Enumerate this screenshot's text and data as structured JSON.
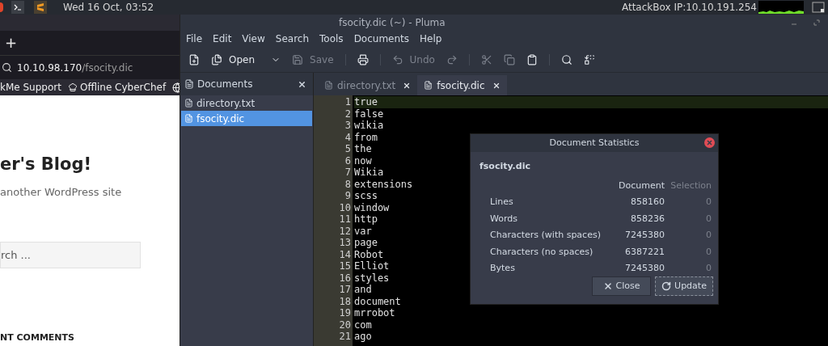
{
  "top_bar": {
    "clock": "Wed 16 Oct, 03:52",
    "attackbox": "AttackBox IP:10.10.191.254"
  },
  "browser": {
    "new_tab": "+",
    "url_host": "10.10.98.170",
    "url_path": "/fsocity.dic",
    "bookmarks": [
      "kMe Support",
      "Offline CyberChef"
    ],
    "page": {
      "title": "er's Blog!",
      "tagline": "another WordPress site",
      "search_placeholder": "rch ...",
      "section": "NT COMMENTS"
    }
  },
  "editor": {
    "title": "fsocity.dic (~) - Pluma",
    "menu": [
      "File",
      "Edit",
      "View",
      "Search",
      "Tools",
      "Documents",
      "Help"
    ],
    "toolbar": [
      {
        "kind": "new",
        "disabled": false
      },
      {
        "kind": "open",
        "label": "Open",
        "disabled": false
      },
      {
        "kind": "save",
        "label": "Save",
        "disabled": true
      },
      {
        "kind": "print",
        "disabled": false
      },
      {
        "kind": "undo",
        "label": "Undo",
        "disabled": true
      },
      {
        "kind": "redo",
        "disabled": true
      },
      {
        "kind": "cut",
        "disabled": true
      },
      {
        "kind": "copy",
        "disabled": true
      },
      {
        "kind": "paste",
        "disabled": false
      },
      {
        "kind": "find",
        "disabled": false
      },
      {
        "kind": "replace",
        "disabled": false
      }
    ],
    "side_panel": {
      "title": "Documents",
      "documents": [
        {
          "name": "directory.txt",
          "selected": false
        },
        {
          "name": "fsocity.dic",
          "selected": true
        }
      ]
    },
    "tabs": [
      {
        "label": "directory.txt",
        "selected": false
      },
      {
        "label": "fsocity.dic",
        "selected": true
      }
    ],
    "lines": [
      {
        "number": "1",
        "text": "true"
      },
      {
        "number": "2",
        "text": "false"
      },
      {
        "number": "3",
        "text": "wikia"
      },
      {
        "number": "4",
        "text": "from"
      },
      {
        "number": "5",
        "text": "the"
      },
      {
        "number": "6",
        "text": "now"
      },
      {
        "number": "7",
        "text": "Wikia"
      },
      {
        "number": "8",
        "text": "extensions"
      },
      {
        "number": "9",
        "text": "scss"
      },
      {
        "number": "10",
        "text": "window"
      },
      {
        "number": "11",
        "text": "http"
      },
      {
        "number": "12",
        "text": "var"
      },
      {
        "number": "13",
        "text": "page"
      },
      {
        "number": "14",
        "text": "Robot"
      },
      {
        "number": "15",
        "text": "Elliot"
      },
      {
        "number": "16",
        "text": "styles"
      },
      {
        "number": "17",
        "text": "and"
      },
      {
        "number": "18",
        "text": "document"
      },
      {
        "number": "19",
        "text": "mrrobot"
      },
      {
        "number": "20",
        "text": "com"
      },
      {
        "number": "21",
        "text": "ago"
      }
    ]
  },
  "dialog": {
    "title": "Document Statistics",
    "file": "fsocity.dic",
    "columns": [
      "Document",
      "Selection"
    ],
    "rows": [
      {
        "label": "Lines",
        "document": "858160",
        "selection": "0"
      },
      {
        "label": "Words",
        "document": "858236",
        "selection": "0"
      },
      {
        "label": "Characters (with spaces)",
        "document": "7245380",
        "selection": "0"
      },
      {
        "label": "Characters (no spaces)",
        "document": "6387221",
        "selection": "0"
      },
      {
        "label": "Bytes",
        "document": "7245380",
        "selection": "0"
      }
    ],
    "buttons": [
      {
        "kind": "close",
        "label": "Close"
      },
      {
        "kind": "update",
        "label": "Update"
      }
    ]
  }
}
